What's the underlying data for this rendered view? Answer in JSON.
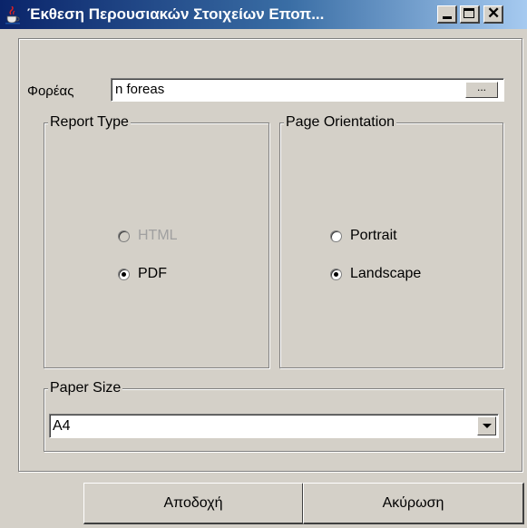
{
  "window": {
    "title": "Έκθεση Περουσιακών Στοιχείων Εποπ...",
    "icon": "java-cup-icon"
  },
  "foreas": {
    "label": "Φορέας",
    "value": "n foreas",
    "browse_label": "..."
  },
  "report_type": {
    "title": "Report Type",
    "options": [
      {
        "label": "HTML",
        "selected": false,
        "enabled": false
      },
      {
        "label": "PDF",
        "selected": true,
        "enabled": true
      }
    ]
  },
  "page_orientation": {
    "title": "Page Orientation",
    "options": [
      {
        "label": "Portrait",
        "selected": false,
        "enabled": true
      },
      {
        "label": "Landscape",
        "selected": true,
        "enabled": true
      }
    ]
  },
  "paper_size": {
    "title": "Paper Size",
    "selected": "A4"
  },
  "buttons": {
    "ok": "Αποδοχή",
    "cancel": "Ακύρωση"
  },
  "colors": {
    "title_gradient_start": "#0a246a",
    "title_gradient_end": "#a6caf0",
    "face": "#d4d0c8"
  }
}
